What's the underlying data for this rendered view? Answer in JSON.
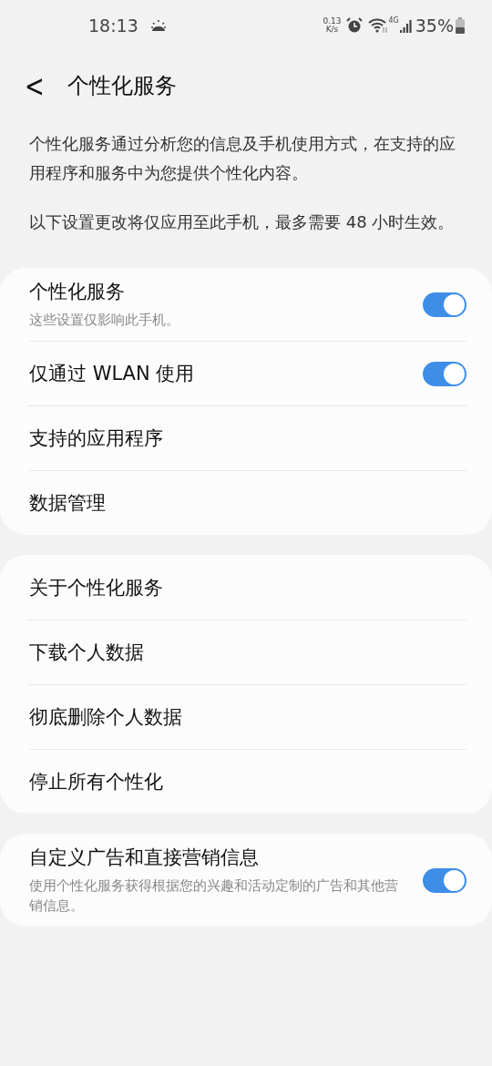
{
  "status_bar": {
    "time": "18:13",
    "net_speed": "0.13",
    "net_unit": "K/s",
    "network_type": "4G",
    "battery": "35%"
  },
  "header": {
    "back": "<",
    "title": "个性化服务"
  },
  "intro": [
    "个性化服务通过分析您的信息及手机使用方式，在支持的应用程序和服务中为您提供个性化内容。",
    "以下设置更改将仅应用至此手机，最多需要 48 小时生效。"
  ],
  "cards": [
    {
      "rows": [
        {
          "kind": "toggle",
          "title": "个性化服务",
          "subtitle": "这些设置仅影响此手机。",
          "on": true
        },
        {
          "kind": "toggle",
          "title": "仅通过 WLAN 使用",
          "on": true
        },
        {
          "kind": "link",
          "title": "支持的应用程序"
        },
        {
          "kind": "link",
          "title": "数据管理"
        }
      ]
    },
    {
      "rows": [
        {
          "kind": "link",
          "title": "关于个性化服务"
        },
        {
          "kind": "link",
          "title": "下载个人数据"
        },
        {
          "kind": "link",
          "title": "彻底删除个人数据"
        },
        {
          "kind": "link",
          "title": "停止所有个性化"
        }
      ]
    },
    {
      "rows": [
        {
          "kind": "toggle",
          "title": "自定义广告和直接营销信息",
          "subtitle": "使用个性化服务获得根据您的兴趣和活动定制的广告和其他营销信息。",
          "on": true
        }
      ]
    }
  ]
}
